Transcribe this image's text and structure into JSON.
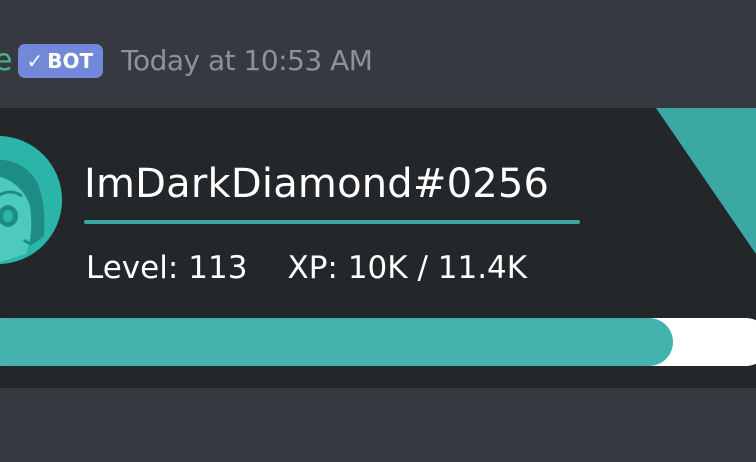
{
  "message": {
    "author_name_visible": "e",
    "bot_badge": {
      "check": "✓",
      "label": "BOT"
    },
    "timestamp": "Today at 10:53 AM"
  },
  "rank_card": {
    "username": "ImDarkDiamond#0256",
    "level_label": "Level:",
    "level": "113",
    "xp_label": "XP:",
    "xp_value": "10K / 11.4K",
    "progress_fraction": 0.877,
    "avatar_icon": "anime-avatar-icon",
    "colors": {
      "card_background": "#23272a",
      "accent": "#3ba8a4",
      "progress_fill": "#44b2ad",
      "progress_track": "#ffffff",
      "bot_badge": "#7289da",
      "username_color": "#43b581",
      "timestamp_color": "#8e9297"
    }
  }
}
